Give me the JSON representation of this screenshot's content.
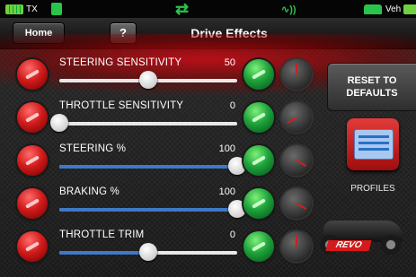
{
  "status_bar": {
    "tx_label": "TX",
    "veh_label": "Veh"
  },
  "nav": {
    "home_label": "Home",
    "help_label": "?",
    "title": "Drive Effects"
  },
  "rows": [
    {
      "label": "STEERING SENSITIVITY",
      "value": "50",
      "slider_fraction": 0.5,
      "fill": false
    },
    {
      "label": "THROTTLE SENSITIVITY",
      "value": "0",
      "slider_fraction": 0.0,
      "fill": false
    },
    {
      "label": "STEERING %",
      "value": "100",
      "slider_fraction": 1.0,
      "fill": true
    },
    {
      "label": "BRAKING %",
      "value": "100",
      "slider_fraction": 1.0,
      "fill": true
    },
    {
      "label": "THROTTLE TRIM",
      "value": "0",
      "slider_fraction": 0.5,
      "fill": true
    }
  ],
  "reset_button": {
    "line1": "RESET TO",
    "line2": "DEFAULTS"
  },
  "profiles": {
    "label": "PROFILES"
  },
  "logo": {
    "text": "REVO"
  },
  "colors": {
    "accent_blue": "#3f78c8",
    "decrease_red": "#d21b1b",
    "increase_green": "#1ea23a"
  }
}
